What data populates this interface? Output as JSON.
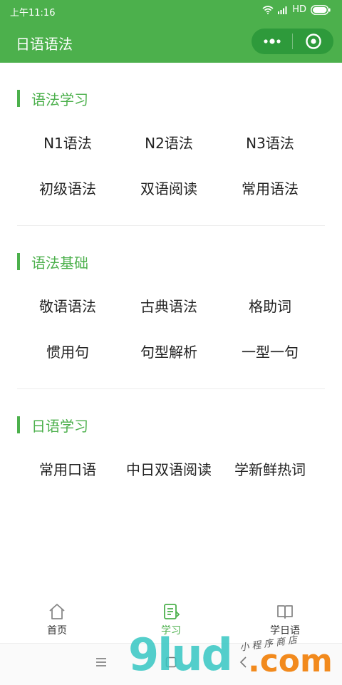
{
  "status_bar": {
    "time": "上午11:16",
    "network": "HD"
  },
  "nav_bar": {
    "title": "日语语法"
  },
  "sections": [
    {
      "title": "语法学习",
      "items": [
        "N1语法",
        "N2语法",
        "N3语法",
        "初级语法",
        "双语阅读",
        "常用语法"
      ]
    },
    {
      "title": "语法基础",
      "items": [
        "敬语语法",
        "古典语法",
        "格助词",
        "惯用句",
        "句型解析",
        "一型一句"
      ]
    },
    {
      "title": "日语学习",
      "items": [
        "常用口语",
        "中日双语阅读",
        "学新鲜热词"
      ]
    }
  ],
  "tab_bar": {
    "tabs": [
      {
        "label": "首页",
        "icon": "home-icon",
        "active": false
      },
      {
        "label": "学习",
        "icon": "study-icon",
        "active": true
      },
      {
        "label": "学日语",
        "icon": "book-icon",
        "active": false
      }
    ]
  },
  "watermark": {
    "brand": "9lud",
    "suffix": ".com",
    "tagline": "小程序商店"
  },
  "colors": {
    "accent": "#4cb04c",
    "capsule": "#2e9a3b",
    "text": "#222222"
  }
}
